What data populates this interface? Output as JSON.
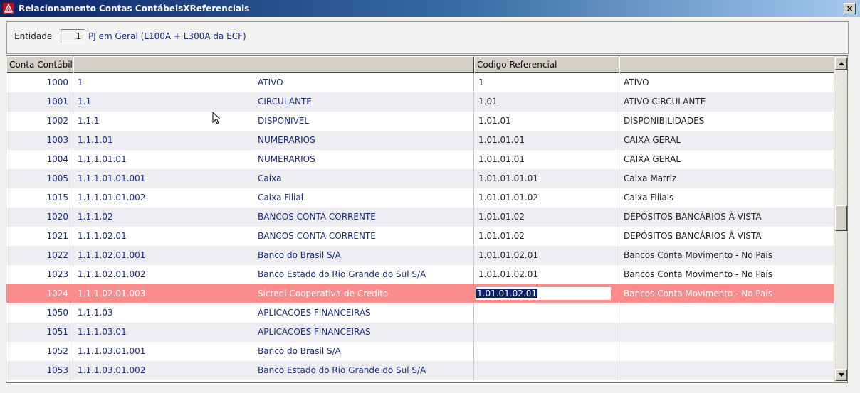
{
  "window": {
    "title": "Relacionamento Contas ContábeisXReferenciais",
    "close_label": "×"
  },
  "filter": {
    "entidade_label": "Entidade",
    "entidade_value": "1",
    "entidade_description": "PJ em Geral (L100A + L300A da ECF)"
  },
  "grid": {
    "columns": [
      "Conta Contábil",
      "",
      "Codigo Referencial",
      ""
    ],
    "rows": [
      {
        "conta": "1000",
        "class": "1",
        "desc": "ATIVO",
        "ref": "1",
        "ref_desc": "ATIVO"
      },
      {
        "conta": "1001",
        "class": "1.1",
        "desc": "CIRCULANTE",
        "ref": "1.01",
        "ref_desc": "ATIVO CIRCULANTE"
      },
      {
        "conta": "1002",
        "class": "1.1.1",
        "desc": "DISPONIVEL",
        "ref": "1.01.01",
        "ref_desc": "DISPONIBILIDADES"
      },
      {
        "conta": "1003",
        "class": "1.1.1.01",
        "desc": "NUMERARIOS",
        "ref": "1.01.01.01",
        "ref_desc": "CAIXA GERAL"
      },
      {
        "conta": "1004",
        "class": "1.1.1.01.01",
        "desc": "NUMERARIOS",
        "ref": "1.01.01.01",
        "ref_desc": "CAIXA GERAL"
      },
      {
        "conta": "1005",
        "class": "1.1.1.01.01.001",
        "desc": "Caixa",
        "ref": "1.01.01.01.01",
        "ref_desc": "Caixa Matriz"
      },
      {
        "conta": "1015",
        "class": "1.1.1.01.01.002",
        "desc": "Caixa Filial",
        "ref": "1.01.01.01.02",
        "ref_desc": "Caixa Filiais"
      },
      {
        "conta": "1020",
        "class": "1.1.1.02",
        "desc": "BANCOS CONTA CORRENTE",
        "ref": "1.01.01.02",
        "ref_desc": "DEPÓSITOS BANCÁRIOS À VISTA"
      },
      {
        "conta": "1021",
        "class": "1.1.1.02.01",
        "desc": "BANCOS CONTA CORRENTE",
        "ref": "1.01.01.02",
        "ref_desc": "DEPÓSITOS BANCÁRIOS À VISTA"
      },
      {
        "conta": "1022",
        "class": "1.1.1.02.01.001",
        "desc": "Banco do Brasil S/A",
        "ref": "1.01.01.02.01",
        "ref_desc": "Bancos Conta Movimento - No País"
      },
      {
        "conta": "1023",
        "class": "1.1.1.02.01.002",
        "desc": "Banco Estado do Rio Grande do Sul S/A",
        "ref": "1.01.01.02.01",
        "ref_desc": "Bancos Conta Movimento - No País"
      },
      {
        "conta": "1024",
        "class": "1.1.1.02.01.003",
        "desc": "Sicredi Cooperativa de Credito",
        "ref": "1.01.01.02.01",
        "ref_desc": "Bancos Conta Movimento - No País",
        "selected": true
      },
      {
        "conta": "1050",
        "class": "1.1.1.03",
        "desc": "APLICACOES FINANCEIRAS",
        "ref": "",
        "ref_desc": ""
      },
      {
        "conta": "1051",
        "class": "1.1.1.03.01",
        "desc": "APLICACOES FINANCEIRAS",
        "ref": "",
        "ref_desc": ""
      },
      {
        "conta": "1052",
        "class": "1.1.1.03.01.001",
        "desc": "Banco do Brasil S/A",
        "ref": "",
        "ref_desc": ""
      },
      {
        "conta": "1053",
        "class": "1.1.1.03.01.002",
        "desc": "Banco Estado do Rio Grande do Sul S/A",
        "ref": "",
        "ref_desc": ""
      }
    ]
  },
  "colors": {
    "title_gradient_start": "#0a246a",
    "selected_row": "#fc8c8c",
    "text_blue": "#1a2a80"
  },
  "icons": {
    "app": "app-logo-icon",
    "close": "close-icon",
    "scroll_up": "arrow-up-icon",
    "scroll_down": "arrow-down-icon",
    "cursor": "mouse-pointer-icon"
  }
}
